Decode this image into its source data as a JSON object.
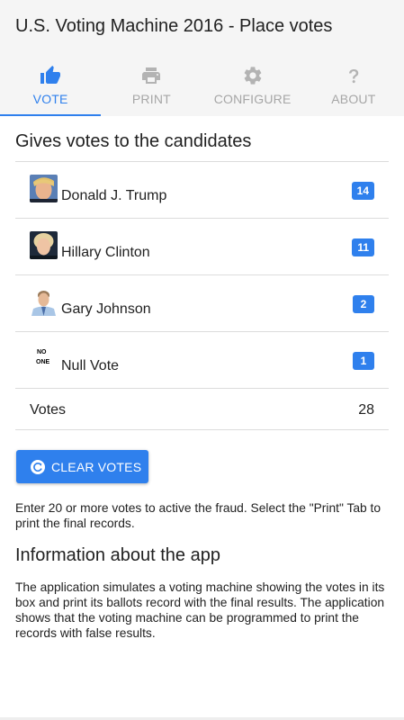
{
  "app": {
    "title": "U.S. Voting Machine 2016 - Place votes"
  },
  "tabs": [
    {
      "label": "VOTE",
      "icon": "thumbs-up-icon",
      "active": true
    },
    {
      "label": "PRINT",
      "icon": "printer-icon",
      "active": false
    },
    {
      "label": "CONFIGURE",
      "icon": "gear-icon",
      "active": false
    },
    {
      "label": "ABOUT",
      "icon": "question-icon",
      "active": false
    }
  ],
  "votes_section": {
    "title": "Gives votes to the candidates",
    "candidates": [
      {
        "name": "Donald J. Trump",
        "votes": "14"
      },
      {
        "name": "Hillary Clinton",
        "votes": "11"
      },
      {
        "name": "Gary Johnson",
        "votes": "2"
      },
      {
        "name": "Null Vote",
        "votes": "1",
        "avatar_text": [
          "NO",
          "ONE"
        ]
      }
    ],
    "total_label": "Votes",
    "total_value": "28"
  },
  "clear_button": {
    "label": "CLEAR VOTES",
    "icon": "refresh-icon"
  },
  "hint": "Enter 20 or more votes to active the fraud. Select the \"Print\" Tab to print the final records.",
  "info": {
    "title": "Information about the app",
    "text": "The application simulates a voting machine showing the votes in its box and print its ballots record with the final results. The application shows that the voting machine can be programmed to print the records with false results."
  },
  "colors": {
    "accent": "#2f80ed",
    "tab_inactive": "#a6a6a6",
    "app_bar": "#f5f5f5"
  }
}
